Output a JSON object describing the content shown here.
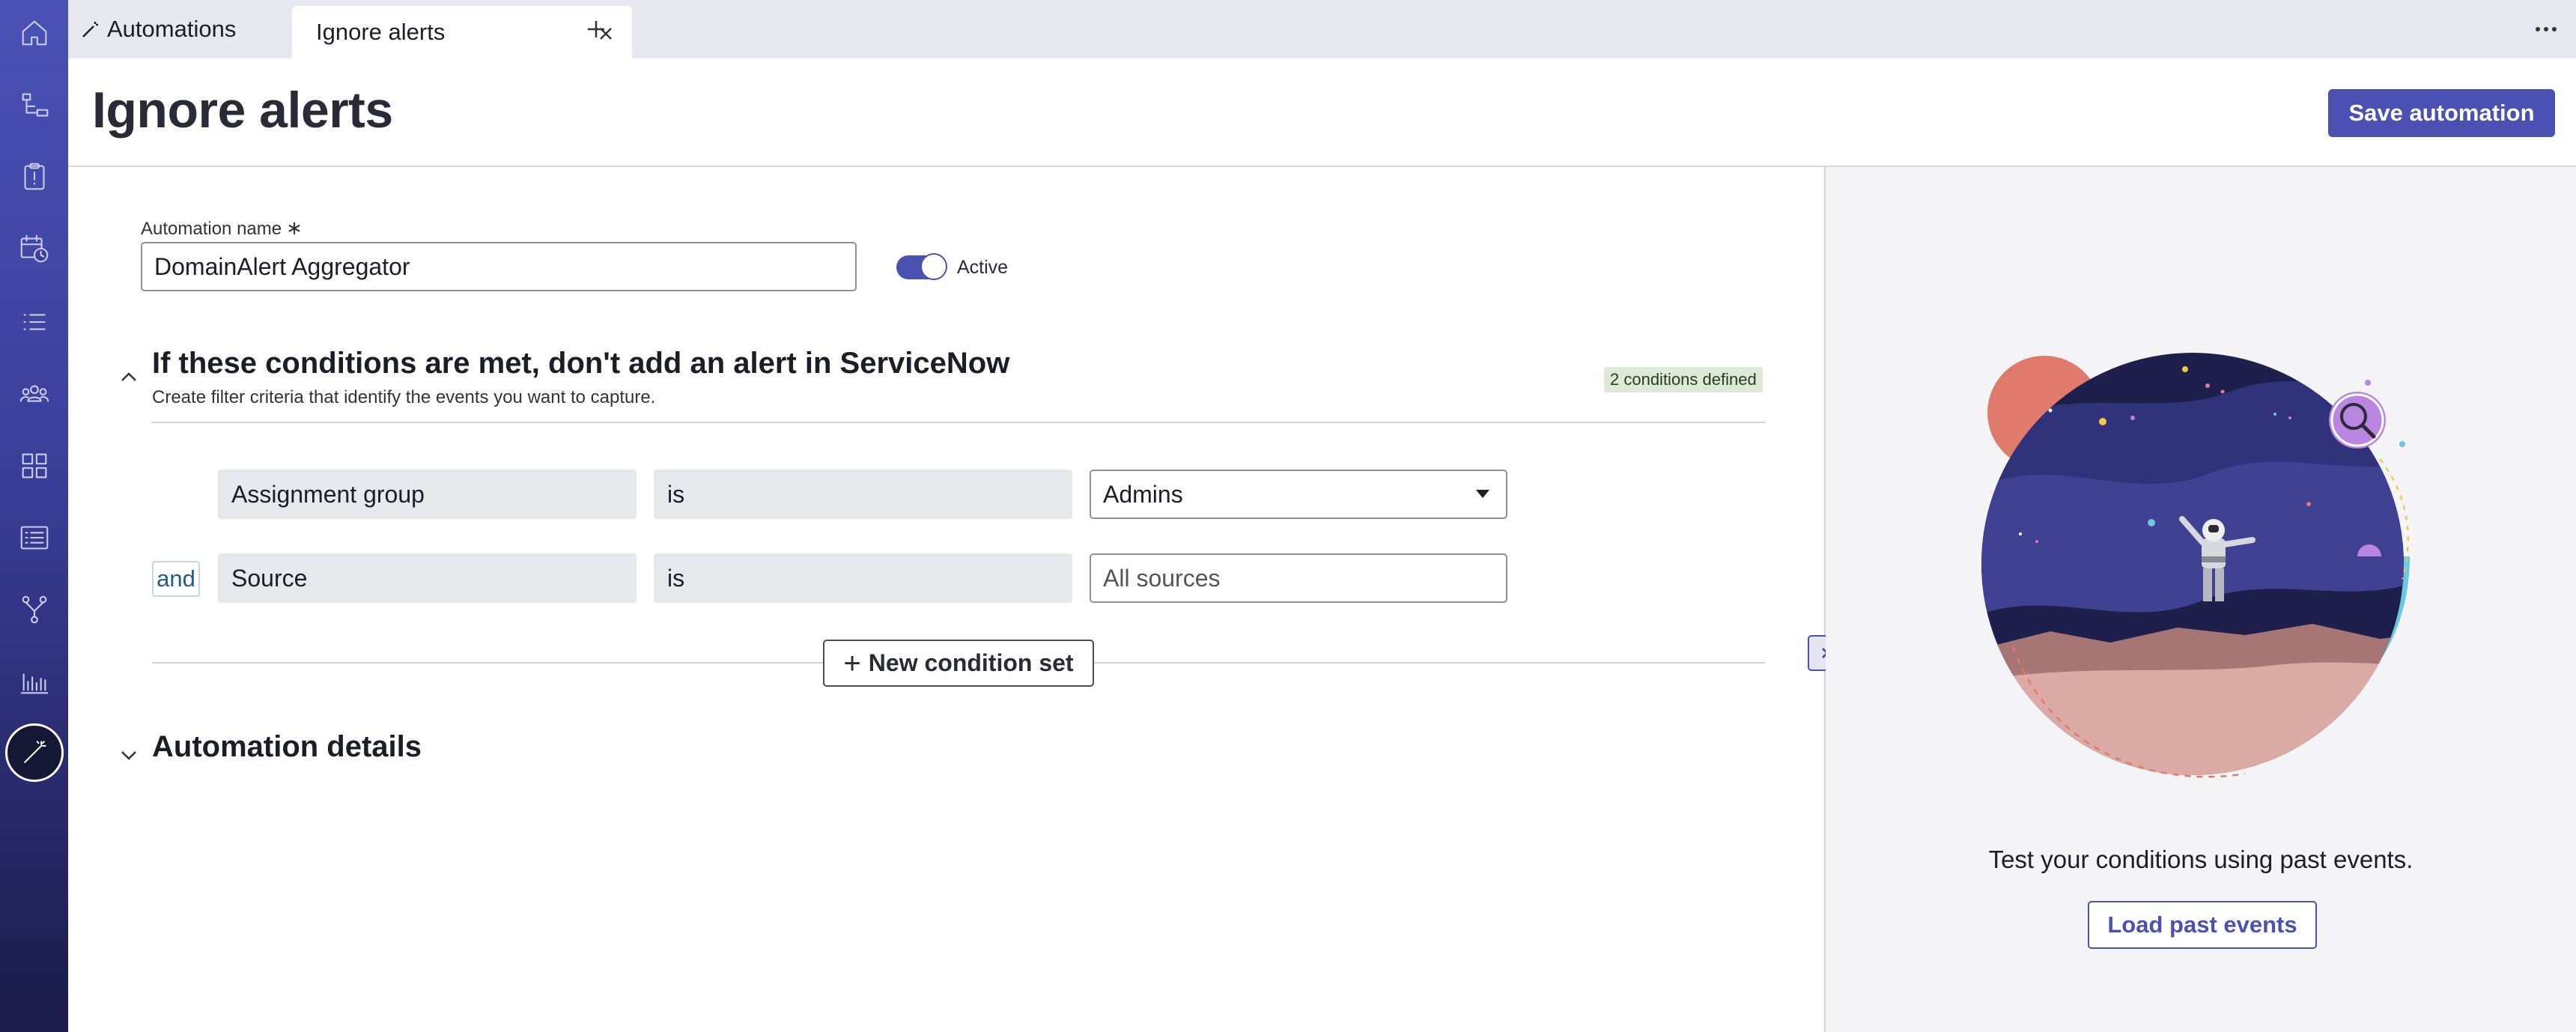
{
  "tabs": {
    "automations_label": "Automations",
    "ignore_label": "Ignore alerts"
  },
  "header": {
    "title": "Ignore alerts",
    "save_label": "Save automation"
  },
  "form": {
    "name_label": "Automation name",
    "required_mark": "∗",
    "name_value": "DomainAlert Aggregator",
    "active_label": "Active",
    "active": true
  },
  "conditions": {
    "title": "If these conditions are met, don't add an alert in ServiceNow",
    "subtitle": "Create filter criteria that identify the events you want to capture.",
    "count_badge": "2 conditions defined",
    "rows": [
      {
        "field": "Assignment group",
        "operator": "is",
        "value": "Admins"
      },
      {
        "connector": "and",
        "field": "Source",
        "operator": "is",
        "placeholder": "All sources"
      }
    ],
    "new_set_label": "New condition set"
  },
  "details": {
    "title": "Automation details"
  },
  "right_panel": {
    "prompt": "Test your conditions using past events.",
    "load_label": "Load past events"
  },
  "colors": {
    "brand": "#4b51b3",
    "badge_bg": "#dde9d5",
    "rail_top": "#4a51b5",
    "rail_bottom": "#1a1b4a"
  },
  "icons": [
    "home-icon",
    "workflow-icon",
    "clipboard-alert-icon",
    "calendar-clock-icon",
    "list-icon",
    "team-icon",
    "grid-icon",
    "list-box-icon",
    "branch-icon",
    "bar-chart-icon",
    "magic-wand-icon"
  ]
}
